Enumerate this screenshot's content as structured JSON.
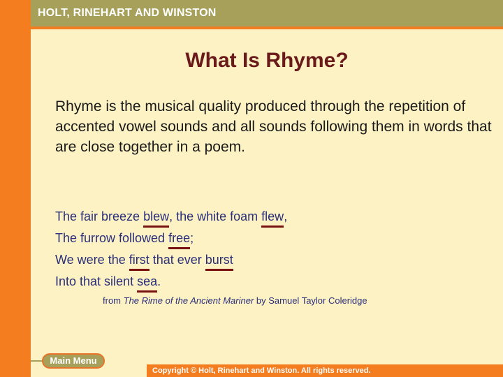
{
  "header": {
    "publisher": "HOLT, RINEHART AND WINSTON"
  },
  "slide": {
    "title": "What Is Rhyme?",
    "definition": "Rhyme is the musical quality produced through the repetition of accented vowel sounds and all sounds following them in words that are close together in a poem."
  },
  "poem": {
    "lines": [
      {
        "before": "The fair breeze ",
        "rhyme1": "blew",
        "middle": ", the white foam ",
        "rhyme2": "flew",
        "after": ","
      },
      {
        "before": "The furrow followed ",
        "rhyme1": "free",
        "after": ";"
      },
      {
        "before": "We were the ",
        "rhyme1": "first",
        "middle": " that ever ",
        "rhyme2": "burst",
        "after": ""
      },
      {
        "before": "Into that silent ",
        "rhyme1": "sea",
        "after": "."
      }
    ],
    "attribution": {
      "prefix": "from ",
      "work": "The Rime of the Ancient Mariner",
      "suffix": " by Samuel Taylor Coleridge"
    }
  },
  "nav": {
    "main_menu_label": "Main Menu"
  },
  "footer": {
    "copyright": "Copyright © Holt, Rinehart and Winston. All rights reserved."
  },
  "colors": {
    "orange": "#f47d20",
    "olive": "#a6a05a",
    "background": "#fdf2c4",
    "title": "#6a1a1a",
    "poem_text": "#2b2f7a",
    "rhyme_underline": "#7a1010"
  }
}
